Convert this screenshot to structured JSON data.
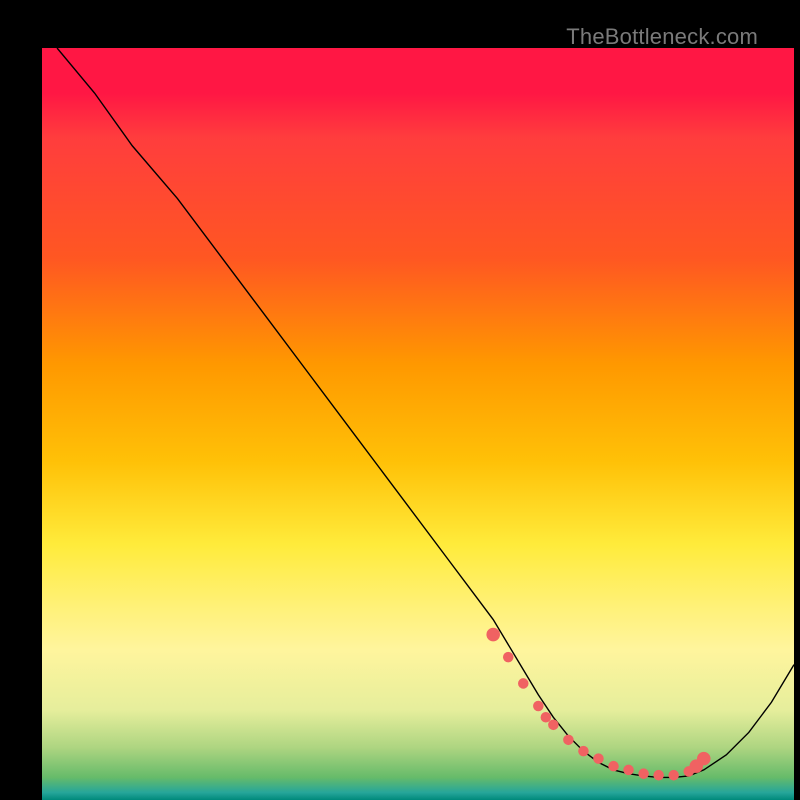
{
  "watermark": "TheBottleneck.com",
  "chart_data": {
    "type": "line",
    "title": "",
    "xlabel": "",
    "ylabel": "",
    "xlim": [
      0,
      100
    ],
    "ylim": [
      0,
      100
    ],
    "grid": false,
    "legend": false,
    "series": [
      {
        "name": "bottleneck-curve",
        "x": [
          2,
          7,
          12,
          18,
          24,
          30,
          36,
          42,
          48,
          54,
          57,
          60,
          63,
          66,
          68,
          70,
          72,
          74,
          76,
          78,
          80,
          82,
          84,
          86,
          88,
          91,
          94,
          97,
          100
        ],
        "y": [
          100,
          94,
          87,
          80,
          72,
          64,
          56,
          48,
          40,
          32,
          28,
          24,
          19,
          14,
          11,
          8.5,
          6.5,
          5,
          4,
          3.5,
          3.2,
          3,
          3,
          3.2,
          4,
          6,
          9,
          13,
          18
        ],
        "color": "#000000"
      }
    ],
    "markers": {
      "name": "optimal-range-dots",
      "x": [
        60,
        62,
        64,
        66,
        67,
        68,
        70,
        72,
        74,
        76,
        78,
        80,
        82,
        84,
        86,
        87,
        88
      ],
      "y": [
        22,
        19,
        15.5,
        12.5,
        11,
        10,
        8,
        6.5,
        5.5,
        4.5,
        4,
        3.5,
        3.3,
        3.3,
        3.8,
        4.5,
        5.5
      ],
      "color": "#f06262",
      "size_small": 5,
      "size_large": 6
    }
  }
}
